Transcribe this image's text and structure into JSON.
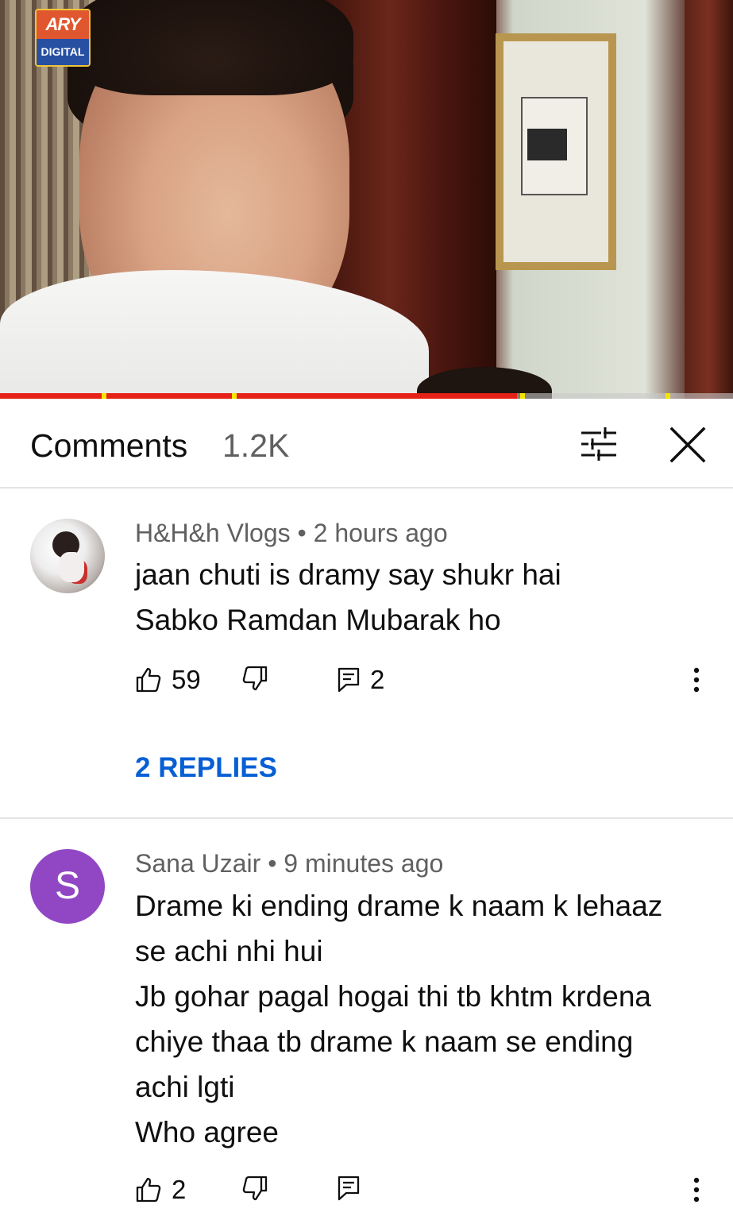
{
  "video": {
    "logo_top": "ARY",
    "logo_bottom": "DIGITAL",
    "progress_fraction": 0.705
  },
  "panel": {
    "title": "Comments",
    "count": "1.2K",
    "sort_icon": "sort-filter-icon",
    "close_icon": "close-icon"
  },
  "comments": [
    {
      "author": "H&H&h Vlogs",
      "separator": "•",
      "time": "2 hours ago",
      "lines": [
        "jaan chuti is dramy say shukr hai",
        "Sabko Ramdan Mubarak ho"
      ],
      "likes": "59",
      "reply_count": "2",
      "replies_label": "2 REPLIES",
      "avatar_type": "photo"
    },
    {
      "author": "Sana Uzair",
      "separator": "•",
      "time": "9 minutes ago",
      "lines": [
        "Drame ki ending drame k naam k lehaaz",
        "se achi nhi hui",
        "Jb gohar pagal hogai thi tb khtm krdena",
        "chiye thaa tb drame k naam se ending",
        "achi lgti",
        "Who agree"
      ],
      "likes": "2",
      "avatar_letter": "S",
      "avatar_color": "#9147c4"
    }
  ],
  "colors": {
    "accent_link": "#065fd4",
    "progress": "#e62117",
    "ad_marker": "#f5e400",
    "secondary_text": "#606060"
  }
}
